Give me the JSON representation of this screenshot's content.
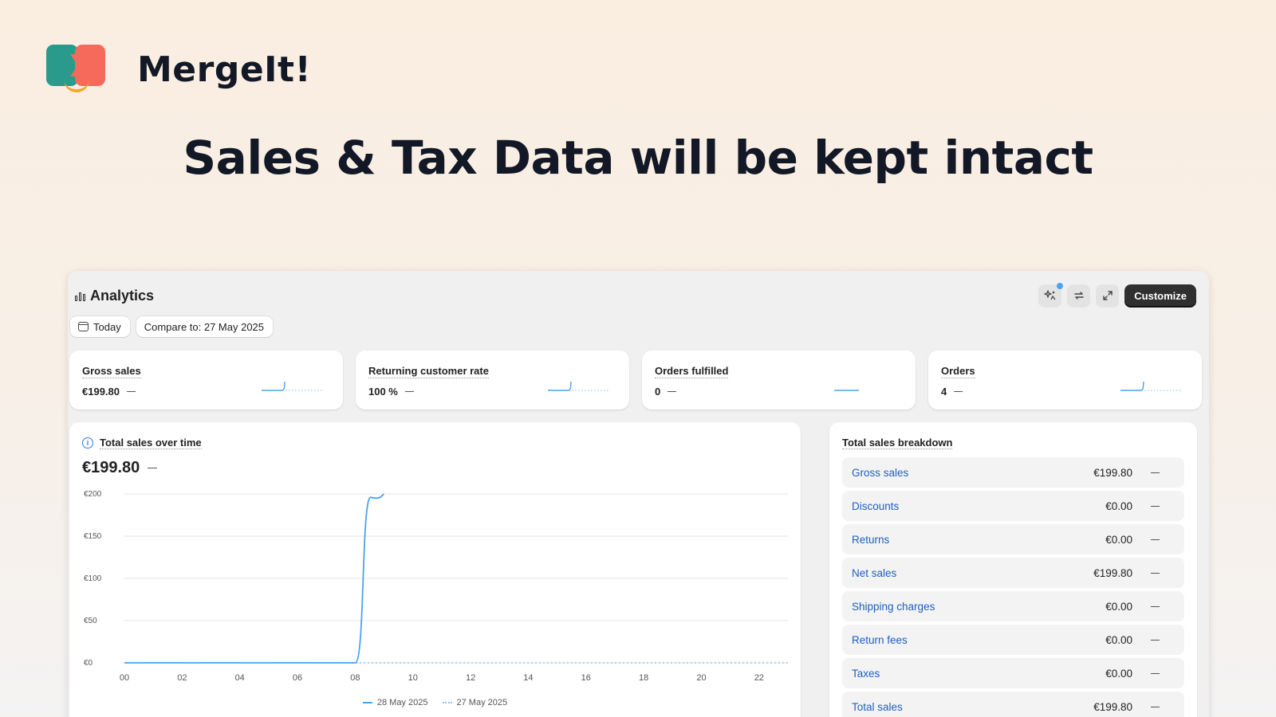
{
  "brand": {
    "name": "MergeIt!"
  },
  "headline": "Sales & Tax Data will be kept intact",
  "app": {
    "title": "Analytics",
    "customize_label": "Customize",
    "filters": {
      "date": "Today",
      "compare": "Compare to: 27 May 2025"
    }
  },
  "metrics": [
    {
      "label": "Gross sales",
      "value": "€199.80",
      "spark": "step"
    },
    {
      "label": "Returning customer rate",
      "value": "100 %",
      "spark": "step"
    },
    {
      "label": "Orders fulfilled",
      "value": "0",
      "spark": "flat"
    },
    {
      "label": "Orders",
      "value": "4",
      "spark": "step"
    }
  ],
  "chart_card": {
    "title": "Total sales over time",
    "total": "€199.80",
    "legend": {
      "current": "28 May 2025",
      "previous": "27 May 2025"
    }
  },
  "chart_data": {
    "type": "line",
    "title": "Total sales over time",
    "xlabel": "",
    "ylabel": "",
    "x": [
      0,
      1,
      2,
      3,
      4,
      5,
      6,
      7,
      8,
      9,
      10,
      11,
      12,
      13,
      14,
      15,
      16,
      17,
      18,
      19,
      20,
      21,
      22,
      23
    ],
    "x_ticks": [
      "00",
      "02",
      "04",
      "06",
      "08",
      "10",
      "12",
      "14",
      "16",
      "18",
      "20",
      "22"
    ],
    "y_ticks": [
      "€0",
      "€50",
      "€100",
      "€150",
      "€200"
    ],
    "ylim": [
      0,
      200
    ],
    "grid": true,
    "legend_position": "bottom",
    "series": [
      {
        "name": "28 May 2025",
        "style": "solid",
        "color": "#4aa3f0",
        "x": [
          0,
          8,
          9
        ],
        "values": [
          0,
          0,
          199.8
        ]
      },
      {
        "name": "27 May 2025",
        "style": "dotted",
        "color": "#8ac3f5",
        "x": [
          0,
          23
        ],
        "values": [
          0,
          0
        ]
      }
    ]
  },
  "breakdown": {
    "title": "Total sales breakdown",
    "rows": [
      {
        "label": "Gross sales",
        "value": "€199.80"
      },
      {
        "label": "Discounts",
        "value": "€0.00"
      },
      {
        "label": "Returns",
        "value": "€0.00"
      },
      {
        "label": "Net sales",
        "value": "€199.80"
      },
      {
        "label": "Shipping charges",
        "value": "€0.00"
      },
      {
        "label": "Return fees",
        "value": "€0.00"
      },
      {
        "label": "Taxes",
        "value": "€0.00"
      },
      {
        "label": "Total sales",
        "value": "€199.80"
      }
    ]
  },
  "icons": [
    "ai-sparkle-icon",
    "refresh-icon",
    "expand-icon",
    "calendar-icon",
    "info-icon",
    "bar-chart-icon"
  ]
}
